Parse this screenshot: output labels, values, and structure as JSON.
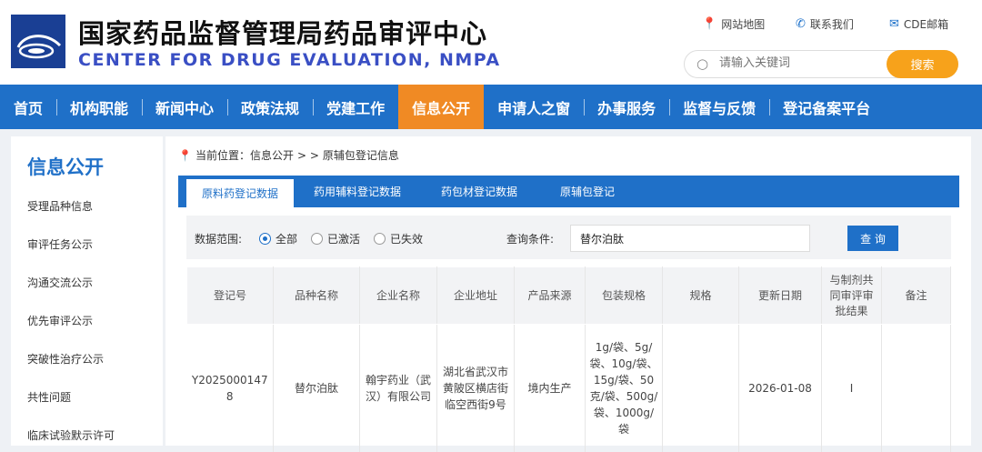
{
  "header": {
    "title_cn": "国家药品监督管理局药品审评中心",
    "title_en": "CENTER FOR DRUG EVALUATION, NMPA",
    "links": [
      {
        "icon": "location-pin-icon",
        "label": "网站地图"
      },
      {
        "icon": "phone-icon",
        "label": "联系我们"
      },
      {
        "icon": "mail-icon",
        "label": "CDE邮箱"
      }
    ],
    "search_placeholder": "请输入关键词",
    "search_button": "搜索"
  },
  "nav": [
    "首页",
    "机构职能",
    "新闻中心",
    "政策法规",
    "党建工作",
    "信息公开",
    "申请人之窗",
    "办事服务",
    "监督与反馈",
    "登记备案平台"
  ],
  "nav_active": "信息公开",
  "sidebar": {
    "title": "信息公开",
    "items": [
      "受理品种信息",
      "审评任务公示",
      "沟通交流公示",
      "优先审评公示",
      "突破性治疗公示",
      "共性问题",
      "临床试验默示许可"
    ]
  },
  "breadcrumb": {
    "prefix": "当前位置：信息公开",
    "sep": ">  >",
    "current": "原辅包登记信息"
  },
  "tabs": [
    "原料药登记数据",
    "药用辅料登记数据",
    "药包材登记数据",
    "原辅包登记"
  ],
  "filter": {
    "range_label": "数据范围:",
    "options": [
      "全部",
      "已激活",
      "已失效"
    ],
    "selected": "全部",
    "cond_label": "查询条件:",
    "cond_value": "替尔泊肽",
    "query_button": "查 询"
  },
  "table": {
    "headers": [
      "登记号",
      "品种名称",
      "企业名称",
      "企业地址",
      "产品来源",
      "包装规格",
      "规格",
      "更新日期",
      "与制剂共同审评审批结果",
      "备注"
    ],
    "rows": [
      [
        "Y20250001478",
        "替尔泊肽",
        "翰宇药业（武汉）有限公司",
        "湖北省武汉市黄陂区横店街临空西街9号",
        "境内生产",
        "1g/袋、5g/袋、10g/袋、15g/袋、50克/袋、500g/袋、1000g/袋",
        "",
        "2026-01-08",
        "I",
        ""
      ]
    ]
  }
}
